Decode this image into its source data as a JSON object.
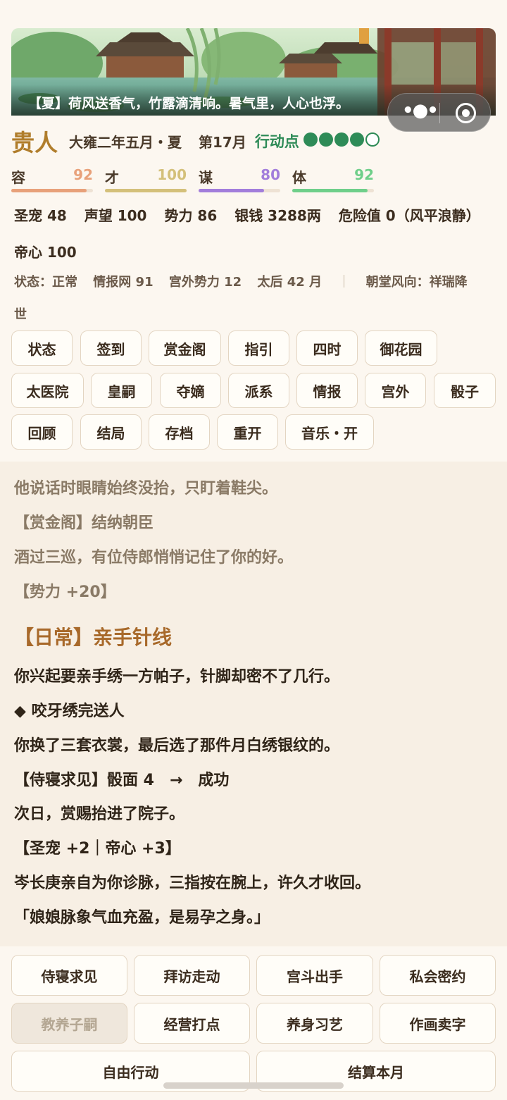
{
  "banner": {
    "caption": "【夏】荷风送香气，竹露滴清响。暑气里，人心也浮。"
  },
  "capsule": {
    "more_icon": "more-dots-icon",
    "close_icon": "target-circle-icon"
  },
  "header": {
    "rank": "贵人",
    "date": "大雍二年五月・夏",
    "month": "第17月",
    "action_label": "行动点",
    "action_points": {
      "filled": 4,
      "total": 5
    }
  },
  "stats": [
    {
      "label": "容",
      "value": "92",
      "fill": 0.92,
      "color": "#e8a17a"
    },
    {
      "label": "才",
      "value": "100",
      "fill": 1.0,
      "color": "#d4c07a"
    },
    {
      "label": "谋",
      "value": "80",
      "fill": 0.8,
      "color": "#a27ddb"
    },
    {
      "label": "体",
      "value": "92",
      "fill": 0.92,
      "color": "#6fcf8a"
    }
  ],
  "info": {
    "favor": "圣宠 48",
    "reputation": "声望 100",
    "power": "势力 86",
    "silver": "银钱 3288两",
    "danger": "危险值 0（风平浪静）",
    "emperor_heart": "帝心 100",
    "status": "状态：正常",
    "intel": "情报网 91",
    "outside": "宫外势力 12",
    "empress_dowager": "太后 42 月",
    "divider": "｜",
    "court_trend_a": "朝堂风向：祥瑞降",
    "court_trend_b": "世"
  },
  "nav": [
    "状态",
    "签到",
    "赏金阁",
    "指引",
    "四时",
    "御花园",
    "太医院",
    "皇嗣",
    "夺嫡",
    "派系",
    "情报",
    "宫外",
    "骰子",
    "回顾",
    "结局",
    "存档",
    "重开",
    "音乐・开"
  ],
  "log": [
    "他说话时眼睛始终没抬，只盯着鞋尖。",
    "【赏金阁】结纳朝臣",
    "酒过三巡，有位侍郎悄悄记住了你的好。",
    "【势力 +20】",
    "【日常】亲手针线",
    "你兴起要亲手绣一方帕子，针脚却密不了几行。",
    "◆ 咬牙绣完送人",
    "你换了三套衣裳，最后选了那件月白绣银纹的。",
    "【侍寝求见】骰面 4　→　成功",
    "次日，赏赐抬进了院子。",
    "【圣宠 +2｜帝心 +3】",
    "岑长庚亲自为你诊脉，三指按在腕上，许久才收回。",
    "「娘娘脉象气血充盈，是易孕之身。」"
  ],
  "actions": [
    "侍寝求见",
    "拜访走动",
    "宫斗出手",
    "私会密约",
    "教养子嗣",
    "经营打点",
    "养身习艺",
    "作画卖字",
    "自由行动",
    "结算本月"
  ],
  "colors": {
    "accent_gold": "#b07d2b",
    "action_green": "#2e8b57",
    "heading_orange": "#a8692a"
  }
}
